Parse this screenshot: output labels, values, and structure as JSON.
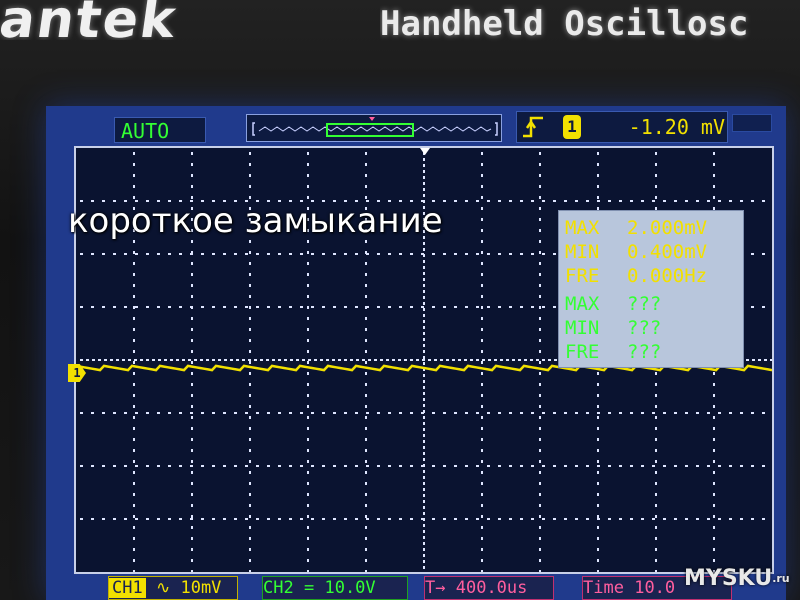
{
  "device": {
    "brand_fragment": "antek",
    "model_text": "Handheld Oscillosc"
  },
  "top_bar": {
    "mode": "AUTO",
    "trigger": {
      "edge_icon": "rising-edge-icon",
      "source": "1",
      "level": "-1.20 mV"
    }
  },
  "measurements": {
    "ch1": [
      {
        "label": "MAX",
        "value": "2.000mV"
      },
      {
        "label": "MIN",
        "value": "0.400mV"
      },
      {
        "label": "FRE",
        "value": "0.000Hz"
      }
    ],
    "ch2": [
      {
        "label": "MAX",
        "value": "???"
      },
      {
        "label": "MIN",
        "value": "???"
      },
      {
        "label": "FRE",
        "value": "???"
      }
    ]
  },
  "channel_marker": "1",
  "overlay_caption": "короткое замыкание",
  "bottom_bar": {
    "ch1_tag": "CH1",
    "ch1_coupling": "∿",
    "ch1_scale": "10mV",
    "ch2_label": "CH2",
    "ch2_coupling": "=",
    "ch2_scale": "10.0V",
    "trigger_label": "T→",
    "trigger_offset": "400.0us",
    "time_label": "Time",
    "time_value": "10.0"
  },
  "watermark": {
    "text": "MYSKU",
    "suffix": ".ru"
  },
  "colors": {
    "ch1": "#f2e000",
    "ch2": "#33ff33",
    "time": "#ff5e9e",
    "screen_bg": "#0a1330",
    "frame": "#203a8c"
  }
}
